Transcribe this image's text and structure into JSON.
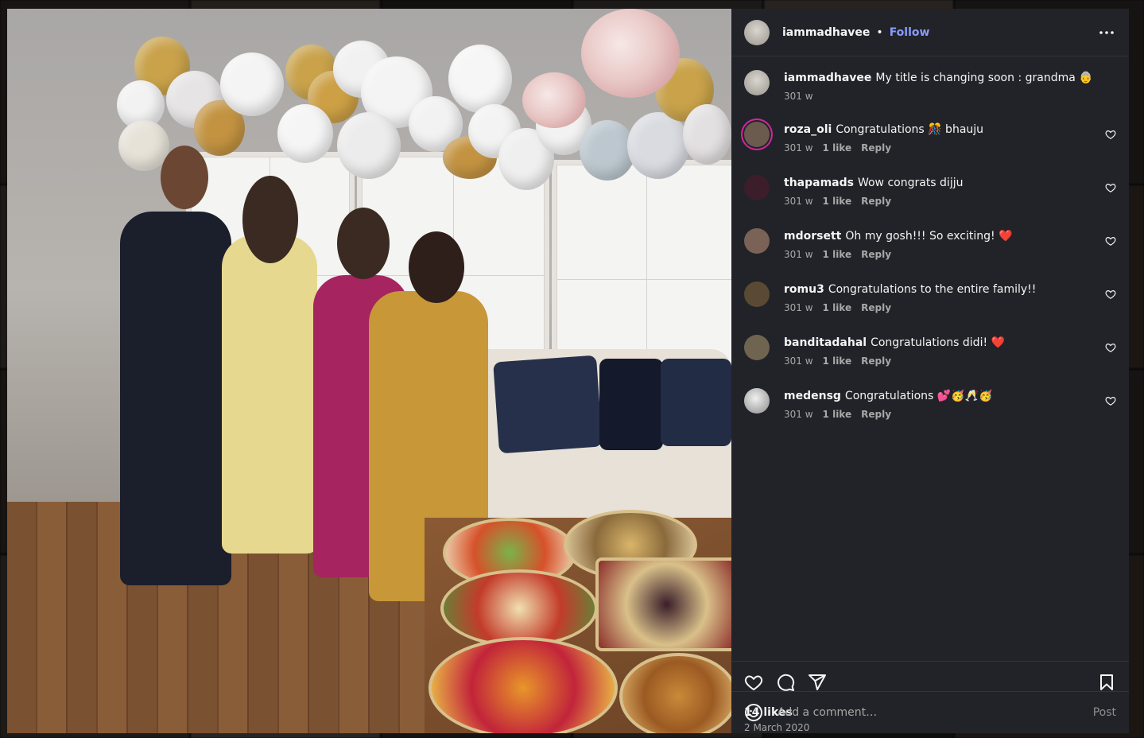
{
  "post": {
    "author": "iammadhavee",
    "follow_label": "Follow",
    "separator": "•",
    "more_label": "More options",
    "caption": {
      "username": "iammadhavee",
      "text": "My title is changing soon : grandma 👵",
      "time": "301 w"
    },
    "comments": [
      {
        "username": "roza_oli",
        "text": "Congratulations 🎊 bhauju",
        "time": "301 w",
        "likes": "1 like",
        "reply": "Reply",
        "avatar_color": "#6b5a4e",
        "story_ring": true
      },
      {
        "username": "thapamads",
        "text": "Wow congrats dijju",
        "time": "301 w",
        "likes": "1 like",
        "reply": "Reply",
        "avatar_color": "#3b1e2a",
        "story_ring": false
      },
      {
        "username": "mdorsett",
        "text": "Oh my gosh!!! So exciting! ❤️",
        "time": "301 w",
        "likes": "1 like",
        "reply": "Reply",
        "avatar_color": "#7a6256",
        "story_ring": false
      },
      {
        "username": "romu3",
        "text": "Congratulations to the entire family!!",
        "time": "301 w",
        "likes": "1 like",
        "reply": "Reply",
        "avatar_color": "#5a4a33",
        "story_ring": false
      },
      {
        "username": "banditadahal",
        "text": "Congratulations didi! ❤️",
        "time": "301 w",
        "likes": "1 like",
        "reply": "Reply",
        "avatar_color": "#6e6450",
        "story_ring": false
      },
      {
        "username": "medensg",
        "text": "Congratulations 💕🥳🥂🥳",
        "time": "301 w",
        "likes": "1 like",
        "reply": "Reply",
        "avatar_color": "#c9c9c9",
        "story_ring": false
      }
    ],
    "likes_count": "14 likes",
    "date": "2 March 2020",
    "add_comment_placeholder": "Add a comment…",
    "post_button": "Post",
    "icons": {
      "like": "heart-icon",
      "comment": "comment-bubble-icon",
      "share": "paper-plane-icon",
      "save": "bookmark-icon",
      "emoji": "smiley-icon",
      "more": "ellipsis-icon"
    }
  },
  "colors": {
    "panel_bg": "#212328",
    "follow": "#8a9bff",
    "text": "#f5f5f5",
    "muted": "#a8a8a8"
  }
}
